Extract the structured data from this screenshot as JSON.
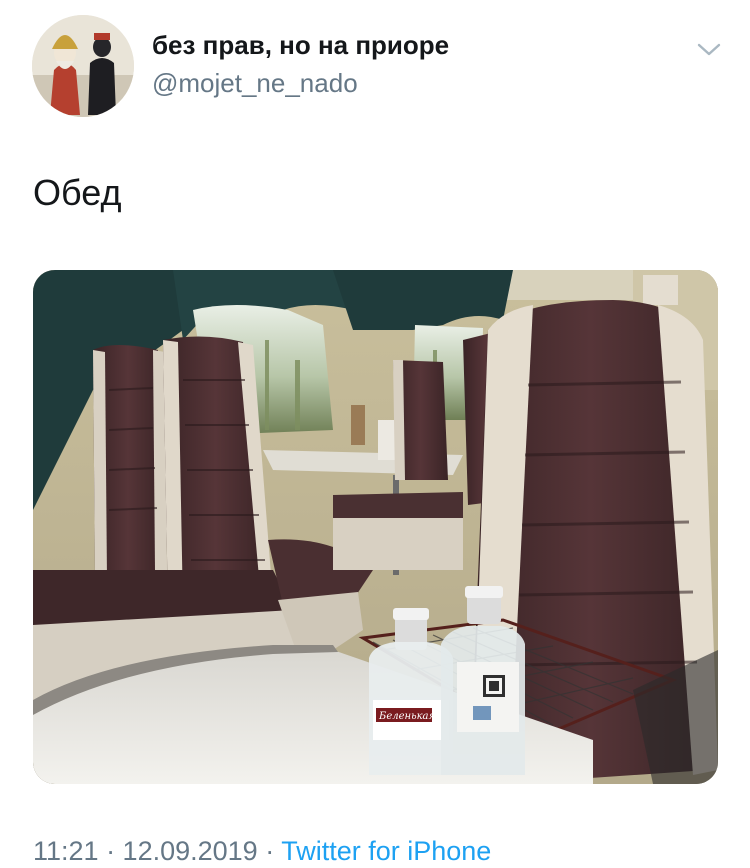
{
  "tweet": {
    "author": {
      "display_name": "без прав, но на приоре",
      "handle": "@mojet_ne_nado"
    },
    "text": "Обед",
    "timestamp": "11:21 · 12.09.2019 ·",
    "source": "Twitter for iPhone"
  },
  "photo": {
    "bottle_label": "Беленькая"
  },
  "icons": {
    "caret": "chevron-down-icon",
    "avatar": "avatar-image"
  },
  "colors": {
    "link": "#1da1f2",
    "secondary_text": "#657786",
    "primary_text": "#14171a"
  }
}
